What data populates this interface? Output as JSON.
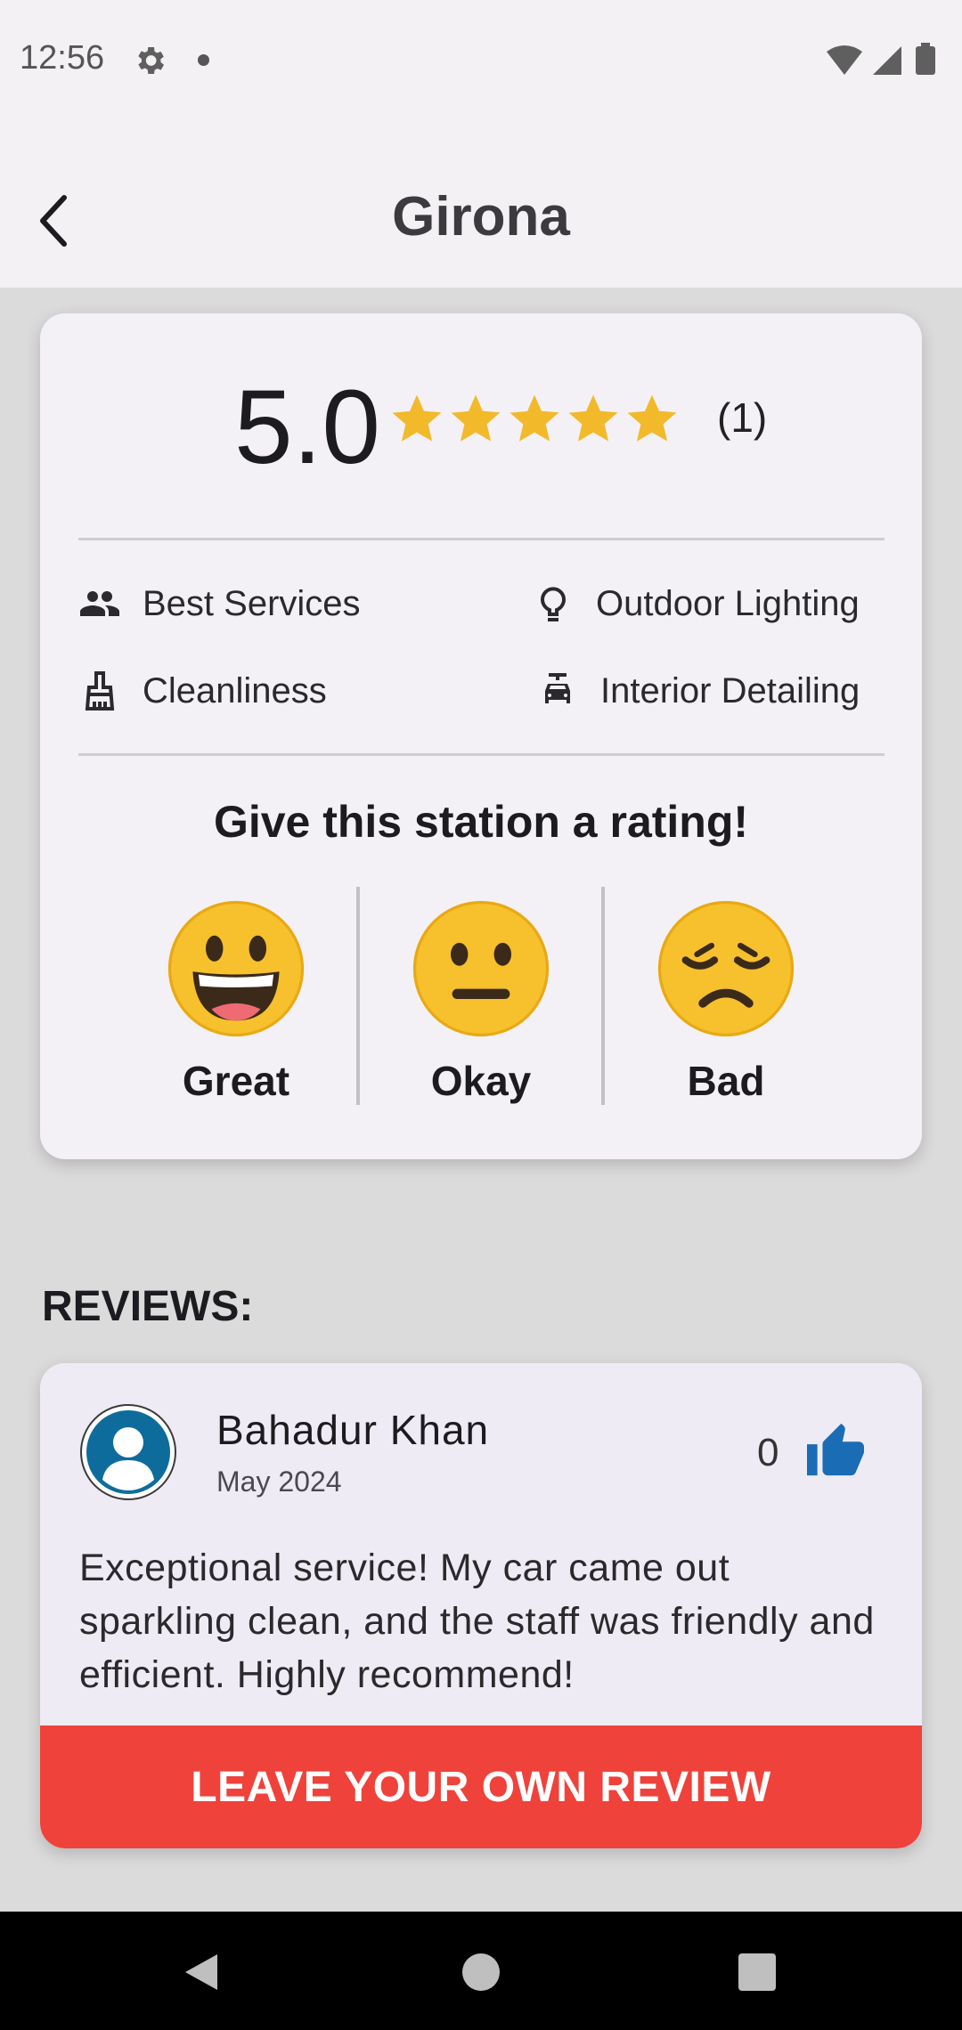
{
  "status_bar": {
    "time": "12:56"
  },
  "app_bar": {
    "title": "Girona"
  },
  "rating": {
    "score": "5.0",
    "stars_filled": 5,
    "stars_total": 5,
    "count": "(1)",
    "star_color": "#f2b92a"
  },
  "features": [
    {
      "icon": "people-icon",
      "label": "Best Services"
    },
    {
      "icon": "lightbulb-icon",
      "label": "Outdoor Lighting"
    },
    {
      "icon": "broom-icon",
      "label": "Cleanliness"
    },
    {
      "icon": "car-seat-icon",
      "label": "Interior Detailing"
    }
  ],
  "rating_prompt": "Give this station a rating!",
  "rating_options": [
    {
      "icon": "grinning-face-icon",
      "label": "Great"
    },
    {
      "icon": "neutral-face-icon",
      "label": "Okay"
    },
    {
      "icon": "disappointed-face-icon",
      "label": "Bad"
    }
  ],
  "reviews": {
    "heading": "REVIEWS:",
    "items": [
      {
        "name": "Bahadur Khan",
        "date": "May 2024",
        "likes": "0",
        "text": "Exceptional service! My car came out sparkling clean, and the staff was friendly and efficient. Highly recommend!"
      }
    ]
  },
  "cta": {
    "label": "LEAVE YOUR OWN REVIEW",
    "color": "#ef423a"
  }
}
